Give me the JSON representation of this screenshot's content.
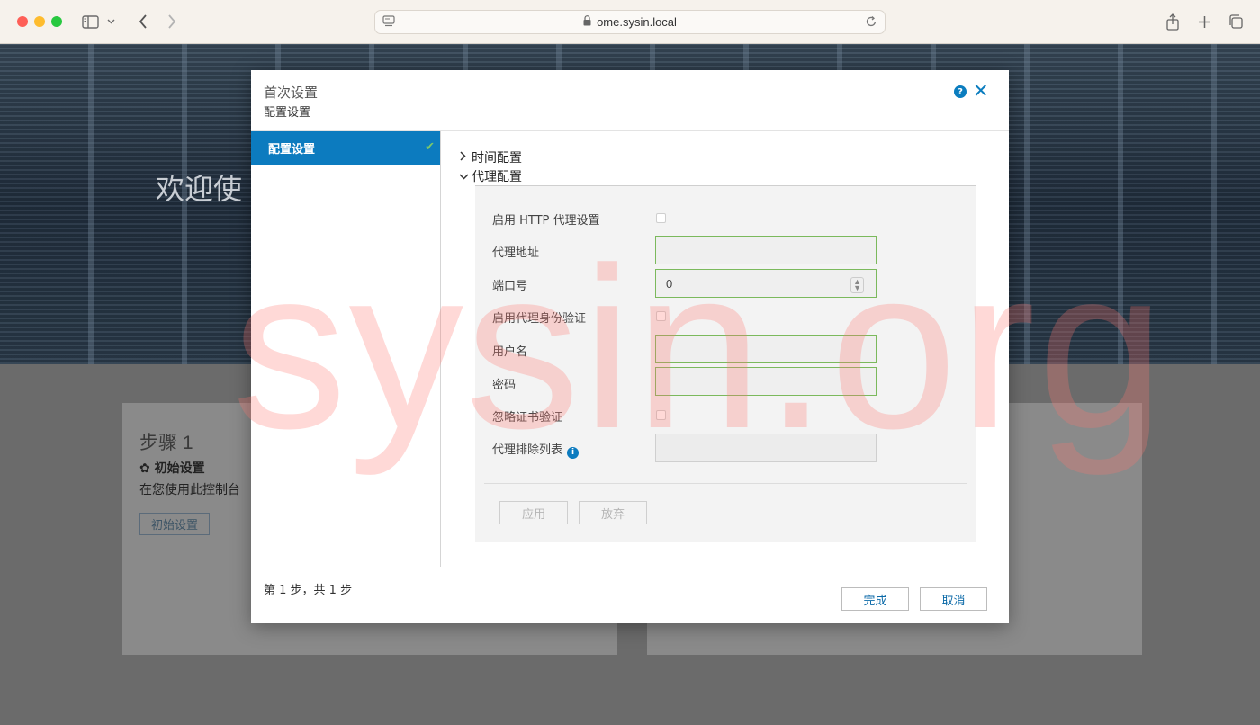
{
  "browser": {
    "url": "ome.sysin.local"
  },
  "background": {
    "hero_title": "欢迎使",
    "card_left": {
      "step": "步骤 1",
      "subtitle": "初始设置",
      "description": "在您使用此控制台",
      "button": "初始设置"
    }
  },
  "modal": {
    "title": "首次设置",
    "subtitle": "配置设置",
    "sidebar": {
      "items": [
        {
          "label": "配置设置",
          "completed": true
        }
      ]
    },
    "sections": [
      {
        "label": "时间配置",
        "expanded": false
      },
      {
        "label": "代理配置",
        "expanded": true
      }
    ],
    "proxy": {
      "enable_http_label": "启用 HTTP 代理设置",
      "address_label": "代理地址",
      "address_value": "",
      "port_label": "端口号",
      "port_value": "0",
      "enable_auth_label": "启用代理身份验证",
      "username_label": "用户名",
      "username_value": "",
      "password_label": "密码",
      "password_value": "",
      "ignore_cert_label": "忽略证书验证",
      "exclusion_label": "代理排除列表",
      "exclusion_value": "",
      "apply_button": "应用",
      "discard_button": "放弃"
    },
    "step_text": "第 1 步，共 1 步",
    "finish_button": "完成",
    "cancel_button": "取消"
  },
  "watermark": "sysin.org",
  "colors": {
    "accent": "#0c7bbf",
    "valid_border": "#7bb95c",
    "watermark": "#ff786e"
  }
}
